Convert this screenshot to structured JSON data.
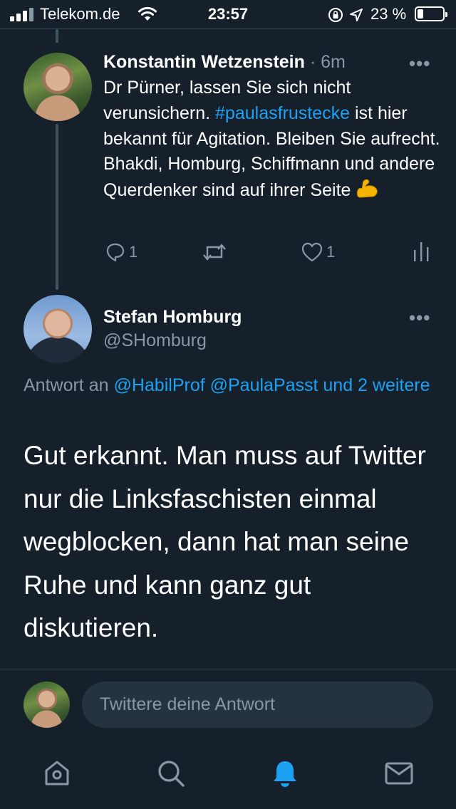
{
  "status_bar": {
    "carrier": "Telekom.de",
    "time": "23:57",
    "battery_percent_label": "23 %",
    "battery_level": 0.23
  },
  "tweet1": {
    "author_name": "Konstantin Wetzenstein",
    "separator_time": "· 6m",
    "text_before_hashtag": "Dr Pürner, lassen Sie sich nicht verunsichern.",
    "hashtag": "#paulasfrustecke",
    "text_after_hashtag": "ist hier bekannt für Agitation. Bleiben Sie aufrecht. Bhakdi, Homburg, Schiffmann und andere Querdenker sind auf ihrer Seite",
    "emoji_icon": "flexed-biceps-icon",
    "reply_count": "1",
    "like_count": "1"
  },
  "tweet2": {
    "author_name": "Stefan Homburg",
    "handle": "@SHomburg",
    "reply_prefix": "Antwort an",
    "reply_mentions": "@HabilProf @PaulaPasst und 2 weitere",
    "text": "Gut erkannt. Man muss auf Twitter nur die Linksfaschisten einmal wegblocken, dann hat man seine Ruhe und kann ganz gut diskutieren."
  },
  "composer": {
    "placeholder": "Twittere deine Antwort"
  },
  "tabbar": {
    "items": [
      "home-icon",
      "search-icon",
      "notifications-icon",
      "messages-icon"
    ],
    "active": "notifications-icon"
  },
  "colors": {
    "background": "#15202b",
    "accent": "#1da1f2",
    "muted": "#8899a6",
    "divider": "#38444d"
  }
}
